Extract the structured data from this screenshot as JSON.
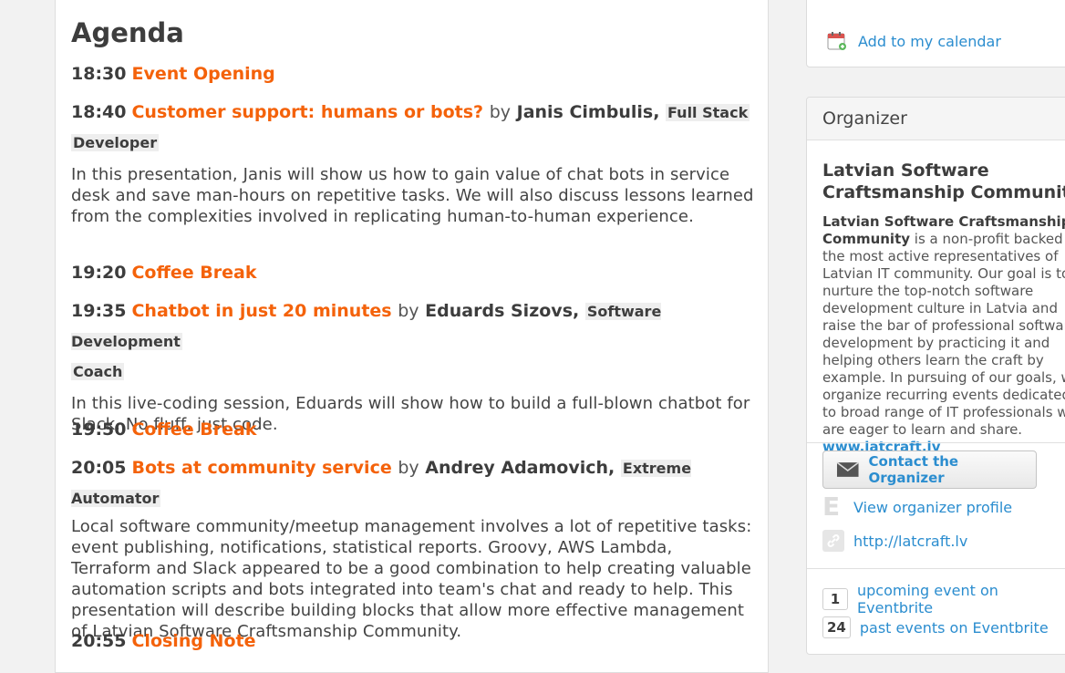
{
  "agenda": {
    "title": "Agenda",
    "slots": [
      {
        "time": "18:30",
        "title": "Event Opening"
      },
      {
        "time": "18:40",
        "title": "Customer support: humans or bots?",
        "by": "by",
        "speaker": "Janis Cimbulis,",
        "role_a": "Full Stack",
        "role_b": "Developer",
        "desc": "In this presentation, Janis will show us how to gain value of chat bots in service desk and save man-hours on repetitive tasks. We will also discuss lessons learned from the complexities involved in replicating human-to-human experience."
      },
      {
        "time": "19:20",
        "title": "Coffee Break"
      },
      {
        "time": "19:35",
        "title": "Chatbot in just 20 minutes",
        "by": "by",
        "speaker": "Eduards Sizovs,",
        "role_a": "Software Development",
        "role_b": "Coach",
        "desc": "In this live-coding session, Eduards will show how to build a full-blown chatbot for Slack. No fluff, just code."
      },
      {
        "time": "19:50",
        "title": "Coffee Break"
      },
      {
        "time": "20:05",
        "title": "Bots at community service",
        "by": "by",
        "speaker": "Andrey Adamovich,",
        "role_a": "Extreme Automator",
        "desc": "Local software community/meetup management involves a lot of repetitive tasks: event publishing, notifications, statistical reports. Groovy, AWS Lambda, Terraform and Slack appeared to be a good combination to help creating valuable automation scripts and bots integrated into team's chat and ready to help. This presentation will describe building blocks that allow more effective management of Latvian Software Craftsmanship Community."
      },
      {
        "time": "20:55",
        "title": "Closing Note"
      }
    ]
  },
  "sidebar": {
    "calendar_link": "Add to my calendar",
    "organizer": {
      "header": "Organizer",
      "name": "Latvian Software Craftsmanship Community",
      "about_bold": "Latvian Software Craftsmanship Community",
      "about_text": " is a non-profit backed by the most active representatives of Latvian IT community. Our goal is to nurture the top-notch software development culture in Latvia and raise the bar of professional software development by practicing it and helping others learn the craft by example. In pursuing of our goals, we organize recurring events dedicated to broad range of IT professionals who are eager to learn and share. ",
      "about_link": "www.latcraft.lv",
      "contact_button": "Contact the Organizer",
      "profile_link": "View organizer profile",
      "website_link": "http://latcraft.lv",
      "upcoming_count": "1",
      "upcoming_label": "upcoming event on Eventbrite",
      "past_count": "24",
      "past_label": "past events on Eventbrite"
    }
  }
}
